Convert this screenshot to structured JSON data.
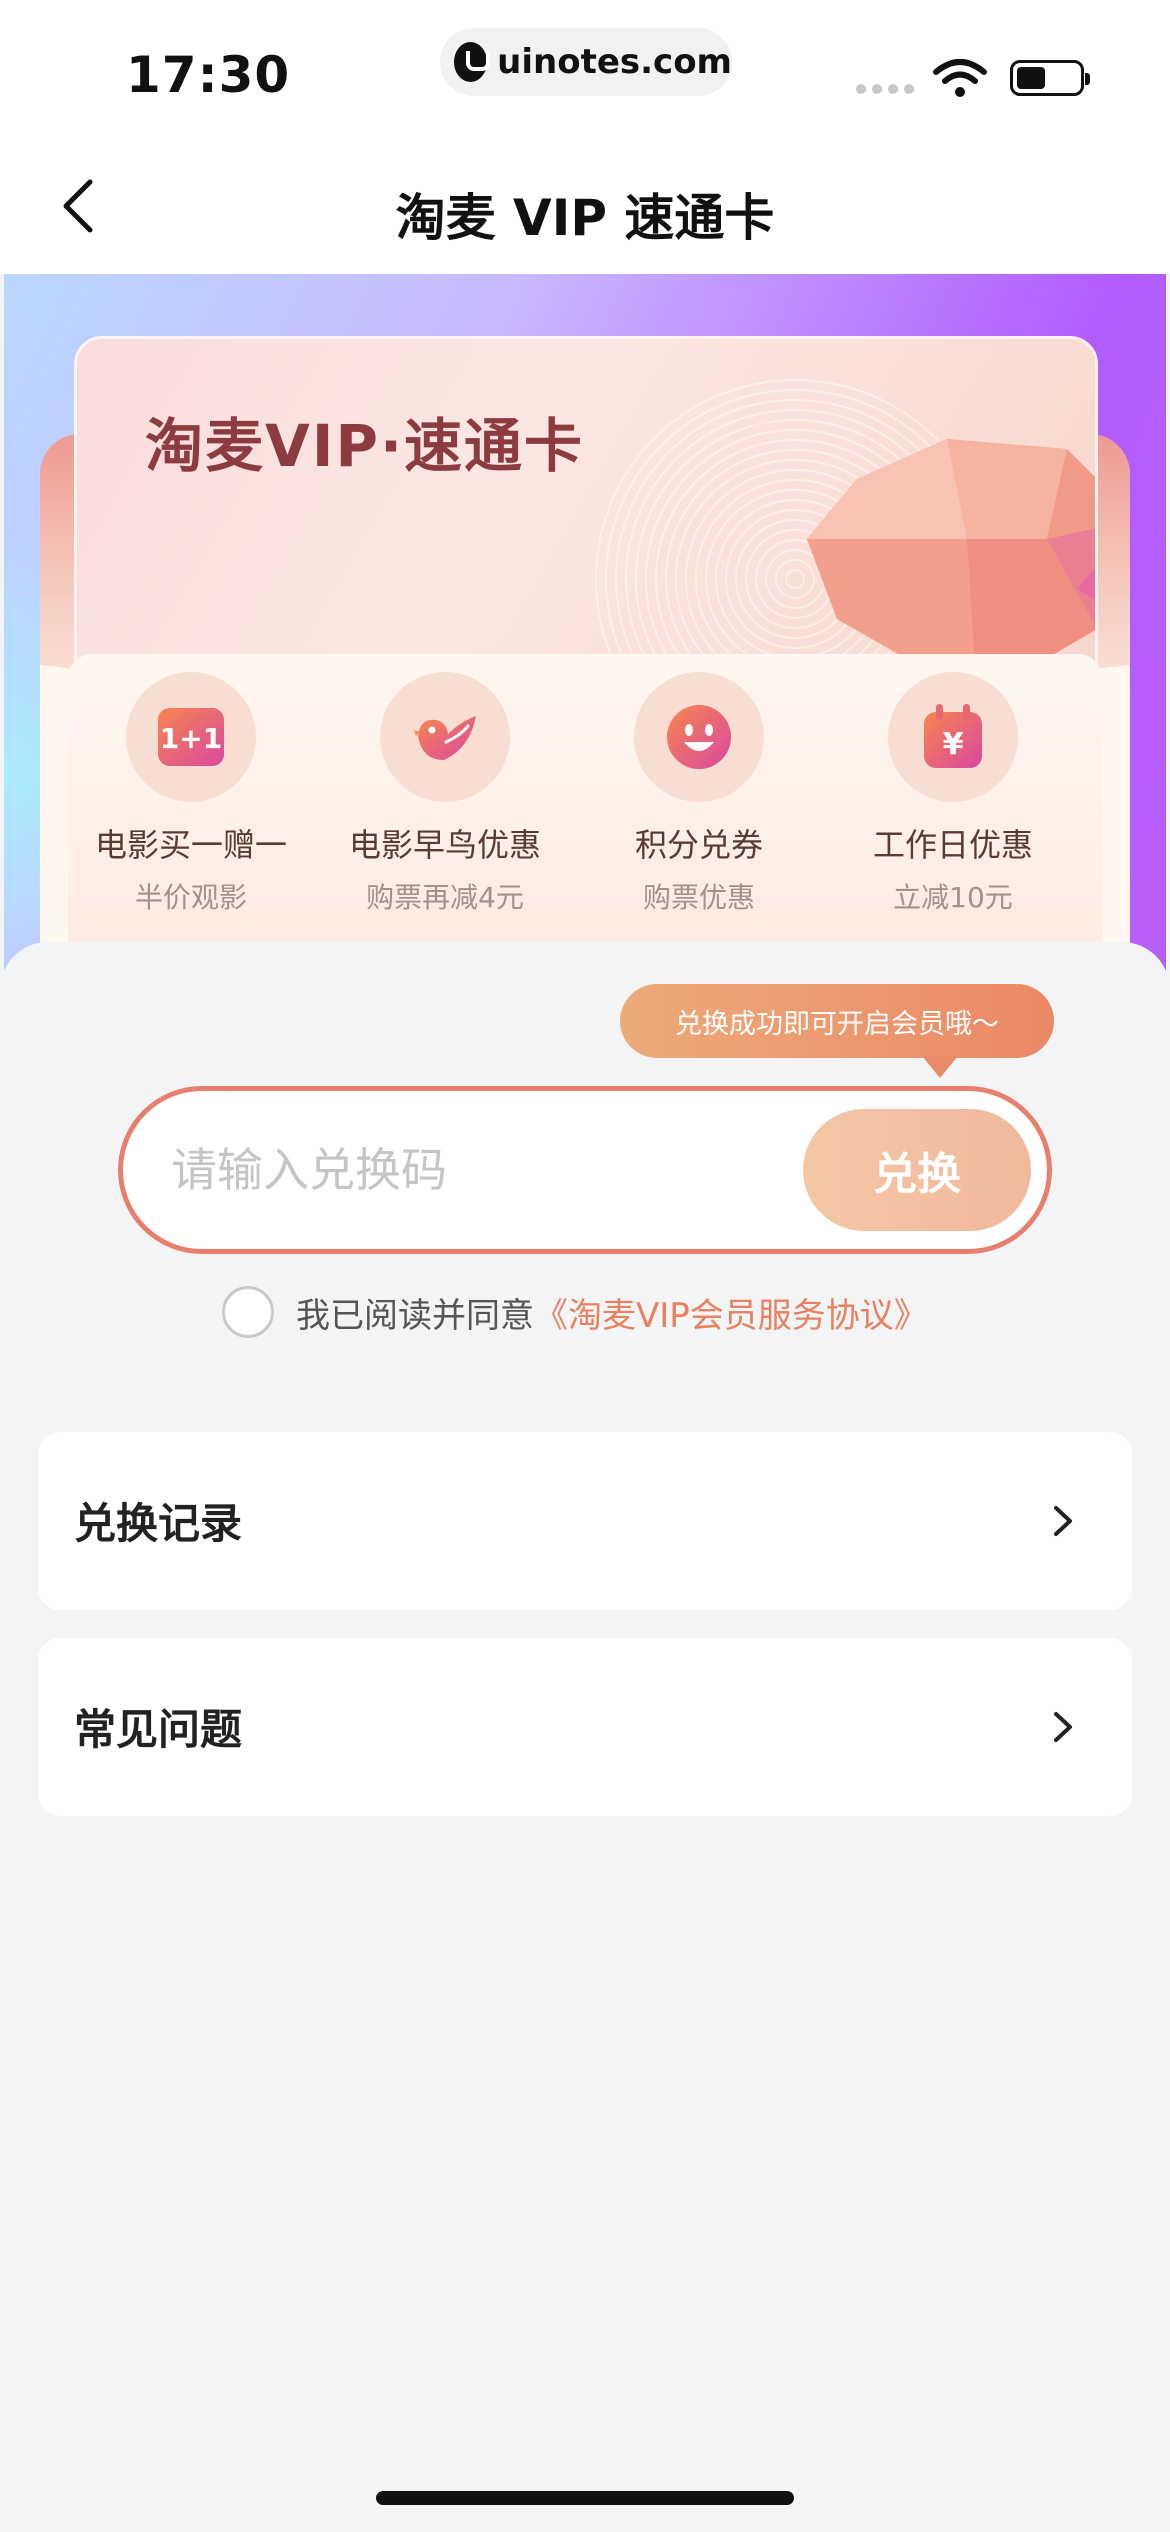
{
  "status_bar": {
    "time": "17:30",
    "url": "uinotes.com",
    "icons": [
      "signal-icon",
      "wifi-icon",
      "battery-icon"
    ]
  },
  "nav": {
    "title": "淘麦 VIP 速通卡",
    "back_icon": "chevron-left-icon"
  },
  "hero": {
    "card_title": "淘麦VIP·速通卡",
    "benefits": [
      {
        "title": "电影买一赠一",
        "subtitle": "半价观影",
        "icon": "one-plus-one-icon"
      },
      {
        "title": "电影早鸟优惠",
        "subtitle": "购票再减4元",
        "icon": "bird-icon"
      },
      {
        "title": "积分兑券",
        "subtitle": "购票优惠",
        "icon": "smile-icon"
      },
      {
        "title": "工作日优惠",
        "subtitle": "立减10元",
        "icon": "calendar-yen-icon"
      }
    ]
  },
  "redeem": {
    "tooltip": "兑换成功即可开启会员哦～",
    "placeholder": "请输入兑换码",
    "button_label": "兑换"
  },
  "agreement": {
    "text": "我已阅读并同意",
    "link": "《淘麦VIP会员服务协议》",
    "checked": false
  },
  "menu": {
    "items": [
      {
        "label": "兑换记录"
      },
      {
        "label": "常见问题"
      }
    ]
  },
  "colors": {
    "accent": "#e87f6e",
    "link": "#e9805f",
    "tooltip_start": "#ecab79",
    "tooltip_end": "#eb8866",
    "hero_purple": "#b25cff"
  }
}
